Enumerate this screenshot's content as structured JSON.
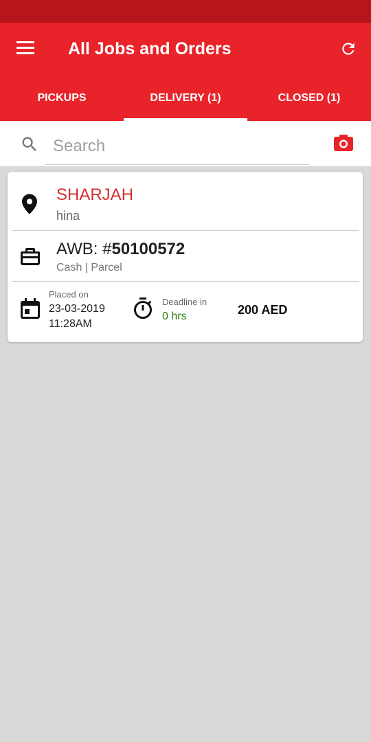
{
  "app_bar": {
    "title": "All Jobs and Orders",
    "menu_icon": "menu-icon",
    "refresh_icon": "refresh-icon"
  },
  "tabs": [
    {
      "label": "PICKUPS",
      "active": false
    },
    {
      "label": "DELIVERY (1)",
      "active": true
    },
    {
      "label": "CLOSED (1)",
      "active": false
    }
  ],
  "search": {
    "placeholder": "Search",
    "value": "",
    "icon": "search-icon",
    "camera_icon": "camera-icon"
  },
  "order": {
    "city": "SHARJAH",
    "customer": "hina",
    "awb_label": "AWB: #",
    "awb_number": "50100572",
    "payment": "Cash | Parcel",
    "placed_label": "Placed on",
    "placed_date": "23-03-2019",
    "placed_time": "11:28AM",
    "deadline_label": "Deadline in",
    "deadline_value": "0 hrs",
    "price": "200 AED"
  },
  "colors": {
    "primary": "#e8232a",
    "status_bar": "#b8141c",
    "city_text": "#d32f2f",
    "deadline_text": "#2e7d12",
    "background": "#d9d9d9"
  }
}
